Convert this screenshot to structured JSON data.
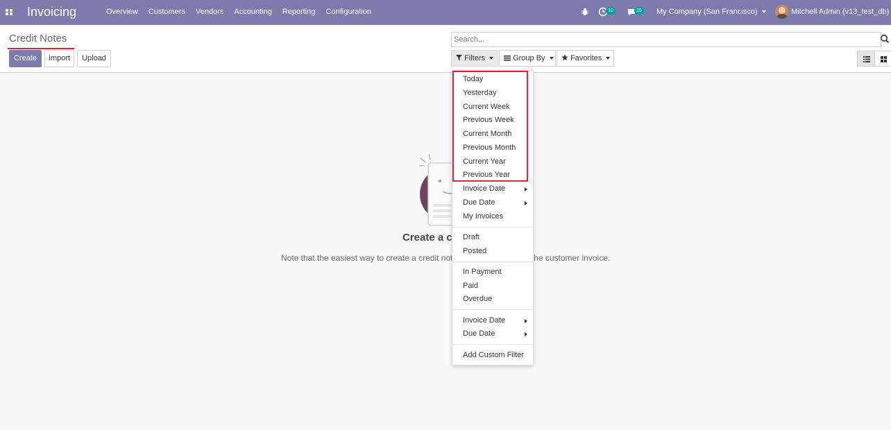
{
  "navbar": {
    "brand": "Invoicing",
    "menu": [
      "Overview",
      "Customers",
      "Vendors",
      "Accounting",
      "Reporting",
      "Configuration"
    ],
    "activity_count": "10",
    "message_count": "15",
    "company": "My Company (San Francisco)",
    "user": "Mitchell Admin (v13_test_db)"
  },
  "control_panel": {
    "breadcrumb": "Credit Notes",
    "create_label": "Create",
    "import_label": "Import",
    "upload_label": "Upload",
    "search_placeholder": "Search...",
    "filters_label": "Filters",
    "group_by_label": "Group By",
    "favorites_label": "Favorites"
  },
  "helper": {
    "title": "Create a c",
    "text": "Note that the easiest way to create a credit not                              m the customer invoice."
  },
  "filters_dropdown": {
    "date_filters": [
      "Today",
      "Yesterday",
      "Current Week",
      "Previous Week",
      "Current Month",
      "Previous Month",
      "Current Year",
      "Previous Year"
    ],
    "date_fields": [
      "Invoice Date",
      "Due Date"
    ],
    "my_invoices": "My Invoices",
    "state_filters": [
      "Draft",
      "Posted"
    ],
    "payment_filters": [
      "In Payment",
      "Paid",
      "Overdue"
    ],
    "date_fields_2": [
      "Invoice Date",
      "Due Date"
    ],
    "add_custom_filter": "Add Custom Filter"
  },
  "colors": {
    "navbar_bg": "#7c7bad",
    "primary": "#7c7bad",
    "badge": "#00a09d",
    "highlight": "#e0262e"
  }
}
